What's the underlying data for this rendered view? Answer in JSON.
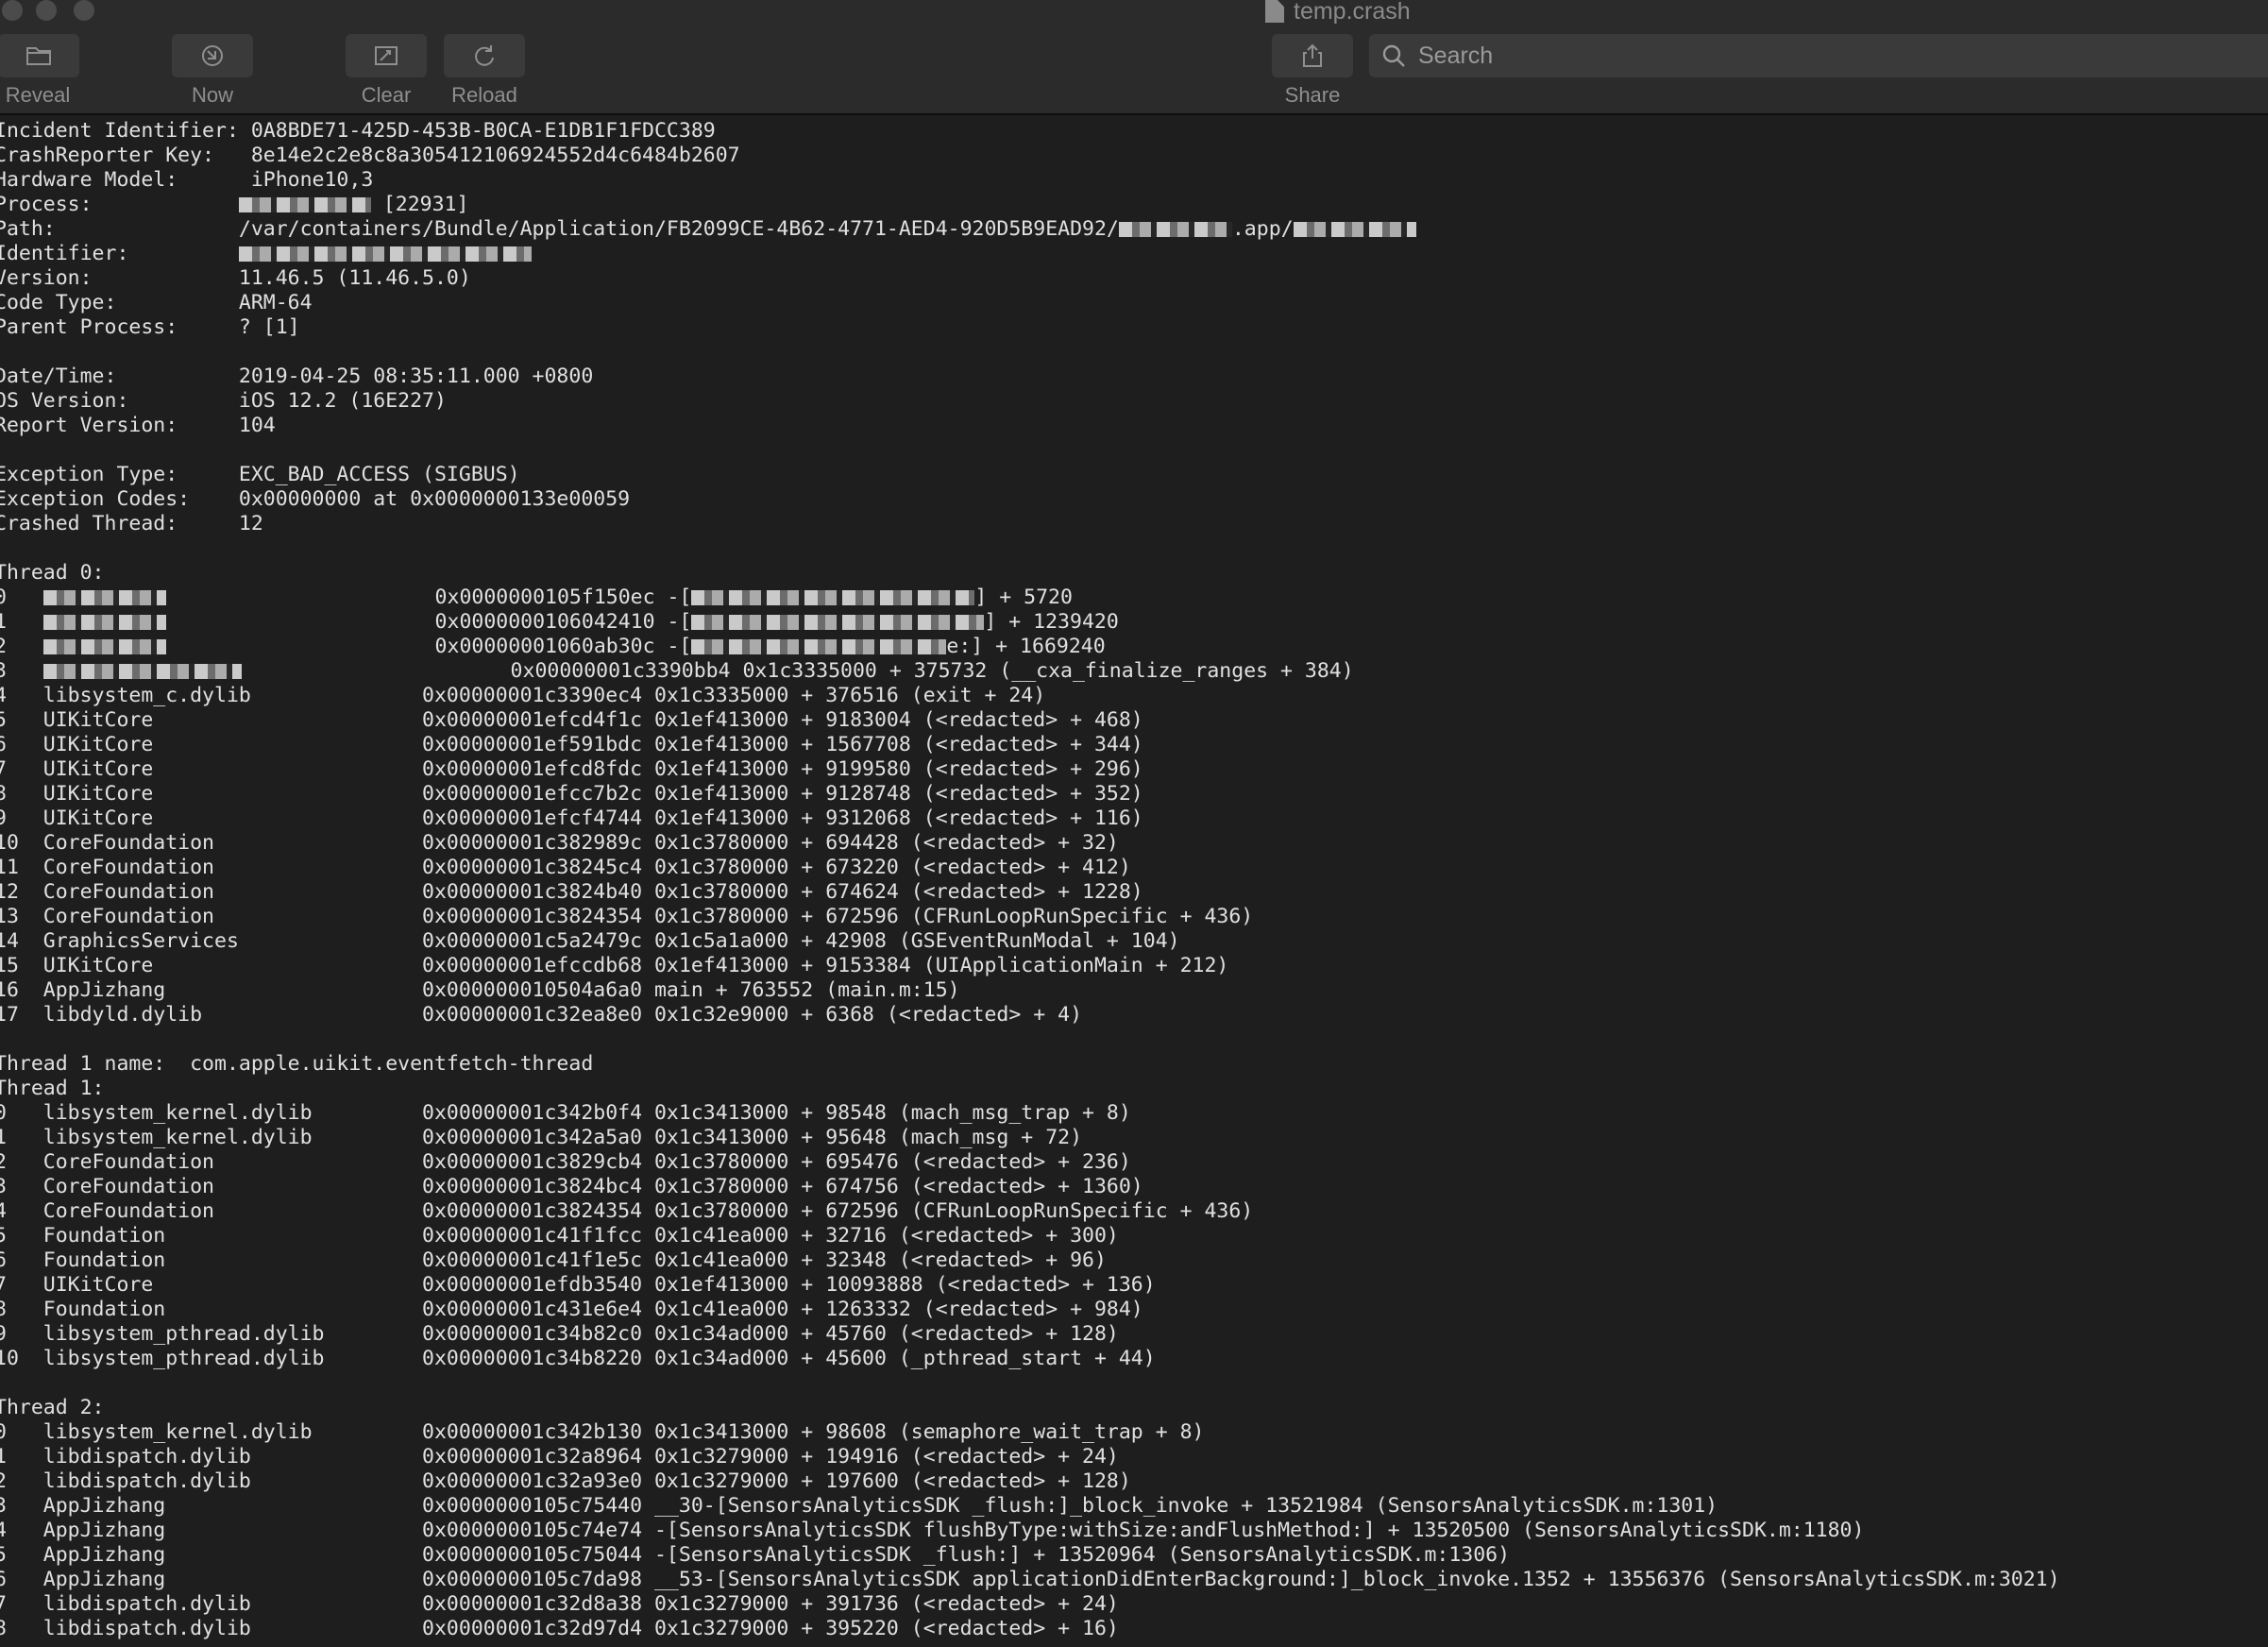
{
  "window": {
    "title": "temp.crash"
  },
  "toolbar": {
    "buttons": [
      {
        "label": "Reveal",
        "icon": "folder-icon"
      },
      {
        "label": "Now",
        "icon": "now-icon"
      },
      {
        "label": "Clear",
        "icon": "clear-icon"
      },
      {
        "label": "Reload",
        "icon": "reload-icon"
      },
      {
        "label": "Share",
        "icon": "share-icon"
      }
    ],
    "search_placeholder": "Search"
  },
  "log": {
    "lines": [
      "Incident Identifier: 0A8BDE71-425D-453B-B0CA-E1DB1F1FDCC389",
      "CrashReporter Key:   8e14e2c2e8c8a305412106924552d4c6484b2607",
      "Hardware Model:      iPhone10,3",
      "Process:            [[B:140]] [22931]",
      "Path:               /var/containers/Bundle/Application/FB2099CE-4B62-4771-AED4-920D5B9EAD92/[[B:120]].app/[[B:130]]",
      "Identifier:         [[B:310]]",
      "Version:            11.46.5 (11.46.5.0)",
      "Code Type:          ARM-64",
      "Parent Process:     ? [1]",
      "",
      "Date/Time:          2019-04-25 08:35:11.000 +0800",
      "OS Version:         iOS 12.2 (16E227)",
      "Report Version:     104",
      "",
      "Exception Type:     EXC_BAD_ACCESS (SIGBUS)",
      "Exception Codes:    0x00000000 at 0x0000000133e00059",
      "Crashed Thread:     12",
      "",
      "Thread 0:",
      "0   [[B:130]]                      0x0000000105f150ec -[[[B:300]]] + 5720",
      "1   [[B:130]]                      0x0000000106042410 -[[[B:310]]] + 1239420",
      "2   [[B:130]]                      0x00000001060ab30c -[[[B:270]]e:] + 1669240",
      "3   [[B:210]]                      0x00000001c3390bb4 0x1c3335000 + 375732 (__cxa_finalize_ranges + 384)",
      "4   libsystem_c.dylib              0x00000001c3390ec4 0x1c3335000 + 376516 (exit + 24)",
      "5   UIKitCore                      0x00000001efcd4f1c 0x1ef413000 + 9183004 (<redacted> + 468)",
      "6   UIKitCore                      0x00000001ef591bdc 0x1ef413000 + 1567708 (<redacted> + 344)",
      "7   UIKitCore                      0x00000001efcd8fdc 0x1ef413000 + 9199580 (<redacted> + 296)",
      "8   UIKitCore                      0x00000001efcc7b2c 0x1ef413000 + 9128748 (<redacted> + 352)",
      "9   UIKitCore                      0x00000001efcf4744 0x1ef413000 + 9312068 (<redacted> + 116)",
      "10  CoreFoundation                 0x00000001c382989c 0x1c3780000 + 694428 (<redacted> + 32)",
      "11  CoreFoundation                 0x00000001c38245c4 0x1c3780000 + 673220 (<redacted> + 412)",
      "12  CoreFoundation                 0x00000001c3824b40 0x1c3780000 + 674624 (<redacted> + 1228)",
      "13  CoreFoundation                 0x00000001c3824354 0x1c3780000 + 672596 (CFRunLoopRunSpecific + 436)",
      "14  GraphicsServices               0x00000001c5a2479c 0x1c5a1a000 + 42908 (GSEventRunModal + 104)",
      "15  UIKitCore                      0x00000001efccdb68 0x1ef413000 + 9153384 (UIApplicationMain + 212)",
      "16  AppJizhang                     0x000000010504a6a0 main + 763552 (main.m:15)",
      "17  libdyld.dylib                  0x00000001c32ea8e0 0x1c32e9000 + 6368 (<redacted> + 4)",
      "",
      "Thread 1 name:  com.apple.uikit.eventfetch-thread",
      "Thread 1:",
      "0   libsystem_kernel.dylib         0x00000001c342b0f4 0x1c3413000 + 98548 (mach_msg_trap + 8)",
      "1   libsystem_kernel.dylib         0x00000001c342a5a0 0x1c3413000 + 95648 (mach_msg + 72)",
      "2   CoreFoundation                 0x00000001c3829cb4 0x1c3780000 + 695476 (<redacted> + 236)",
      "3   CoreFoundation                 0x00000001c3824bc4 0x1c3780000 + 674756 (<redacted> + 1360)",
      "4   CoreFoundation                 0x00000001c3824354 0x1c3780000 + 672596 (CFRunLoopRunSpecific + 436)",
      "5   Foundation                     0x00000001c41f1fcc 0x1c41ea000 + 32716 (<redacted> + 300)",
      "6   Foundation                     0x00000001c41f1e5c 0x1c41ea000 + 32348 (<redacted> + 96)",
      "7   UIKitCore                      0x00000001efdb3540 0x1ef413000 + 10093888 (<redacted> + 136)",
      "8   Foundation                     0x00000001c431e6e4 0x1c41ea000 + 1263332 (<redacted> + 984)",
      "9   libsystem_pthread.dylib        0x00000001c34b82c0 0x1c34ad000 + 45760 (<redacted> + 128)",
      "10  libsystem_pthread.dylib        0x00000001c34b8220 0x1c34ad000 + 45600 (_pthread_start + 44)",
      "",
      "Thread 2:",
      "0   libsystem_kernel.dylib         0x00000001c342b130 0x1c3413000 + 98608 (semaphore_wait_trap + 8)",
      "1   libdispatch.dylib              0x00000001c32a8964 0x1c3279000 + 194916 (<redacted> + 24)",
      "2   libdispatch.dylib              0x00000001c32a93e0 0x1c3279000 + 197600 (<redacted> + 128)",
      "3   AppJizhang                     0x0000000105c75440 __30-[SensorsAnalyticsSDK _flush:]_block_invoke + 13521984 (SensorsAnalyticsSDK.m:1301)",
      "4   AppJizhang                     0x0000000105c74e74 -[SensorsAnalyticsSDK flushByType:withSize:andFlushMethod:] + 13520500 (SensorsAnalyticsSDK.m:1180)",
      "5   AppJizhang                     0x0000000105c75044 -[SensorsAnalyticsSDK _flush:] + 13520964 (SensorsAnalyticsSDK.m:1306)",
      "6   AppJizhang                     0x0000000105c7da98 __53-[SensorsAnalyticsSDK applicationDidEnterBackground:]_block_invoke.1352 + 13556376 (SensorsAnalyticsSDK.m:3021)",
      "7   libdispatch.dylib              0x00000001c32d8a38 0x1c3279000 + 391736 (<redacted> + 24)",
      "8   libdispatch.dylib              0x00000001c32d97d4 0x1c3279000 + 395220 (<redacted> + 16)"
    ]
  }
}
